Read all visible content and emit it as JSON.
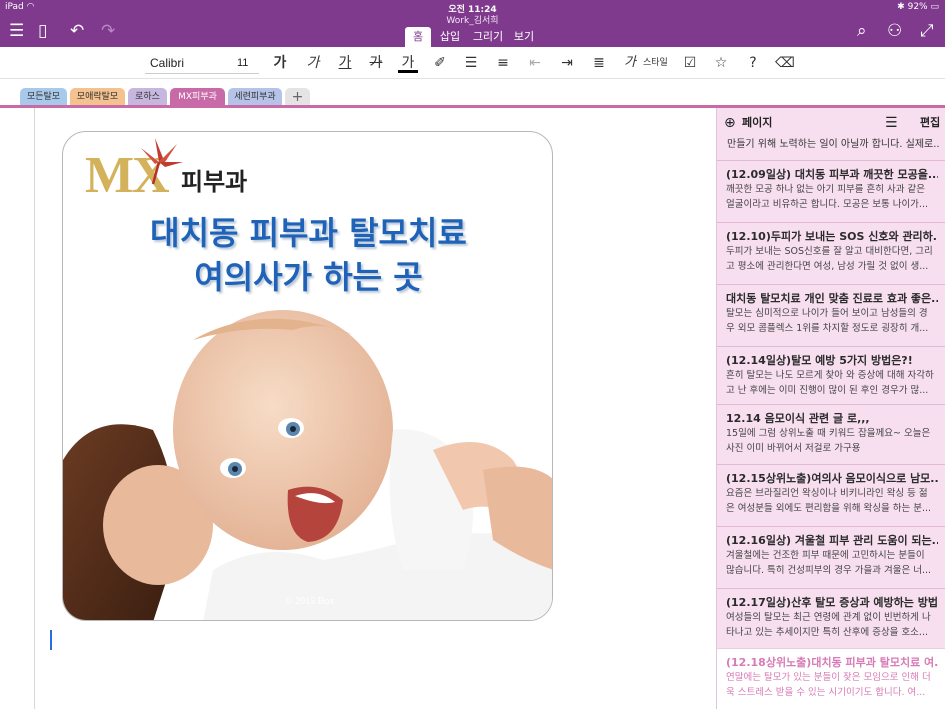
{
  "status": {
    "device": "iPad",
    "time": "오전 11:24",
    "battery": "92%"
  },
  "notebook_title": "Work_김서희",
  "ribbon_tabs": [
    "홈",
    "삽입",
    "그리기",
    "보기"
  ],
  "toolbar": {
    "font_name": "Calibri",
    "font_size": "11",
    "bold": "가",
    "italic": "가",
    "underline": "가",
    "strike": "가",
    "font_color": "가",
    "style_label": "스타일",
    "style_glyph": "가",
    "help": "?"
  },
  "sections": [
    {
      "label": "모든탈모",
      "color": "#a9c9ea"
    },
    {
      "label": "모애락탈모",
      "color": "#f3c28e"
    },
    {
      "label": "로하스",
      "color": "#c7b7de"
    },
    {
      "label": "MX피부과",
      "color": "#c86aa7"
    },
    {
      "label": "세련피부과",
      "color": "#b6c3e8"
    }
  ],
  "card": {
    "logo_mx": "MX",
    "logo_clinic": "피부과",
    "headline_1": "대치동 피부과 탈모치료",
    "headline_2": "여의사가 하는 곳",
    "copyright": "© 2015 Box"
  },
  "panel": {
    "add_label": "페이지",
    "edit_label": "편집",
    "top_snippet": "만들기 위해 노력하는 일이 아닐까 합니다.  실제로...",
    "pages": [
      {
        "title": "(12.09일상) 대치동 피부과 깨끗한 모공을...",
        "line1": "깨끗한 모공 하나 없는 아기 피부를 흔히 사과 같은",
        "line2": "얼굴이라고 비유하곤 합니다.  모공은 보통 나이가..."
      },
      {
        "title": "(12.10)두피가 보내는 SOS 신호와 관리하...",
        "line1": "두피가 보내는 SOS신호를 잘 알고 대비한다면, 그리",
        "line2": "고 평소에 관리한다면 여성, 남성 가릴 것 없이 생..."
      },
      {
        "title": "대치동 탈모치료 개인 맞춤 진료로 효과 좋은...",
        "line1": "탈모는 심미적으로 나이가 들어 보이고 남성들의 경",
        "line2": "우 외모 콤플렉스 1위를 차지할 정도로 굉장히 개..."
      },
      {
        "title": "(12.14일상)탈모 예방 5가지 방법은?!",
        "line1": "흔히 탈모는 나도 모르게 찾아 와 증상에 대해 자각하",
        "line2": "고 난 후에는 이미 진행이 많이 된 후인 경우가 많..."
      },
      {
        "title": "12.14 음모이식 관련 글 로,,,",
        "line1": "15일에 그럼 상위노출 때 키워드 잡을께요~ 오늘은",
        "line2": "사진 이미 바뀌어서 저걸로 가구용"
      },
      {
        "title": "(12.15상위노출)여의사 음모이식으로 남모...",
        "line1": "요즘은 브라질리언 왁싱이나 비키니라인 왁싱 등 젊",
        "line2": "은 여성분들 외에도 편리함을 위해 왁싱을 하는 분..."
      },
      {
        "title": "(12.16일상) 겨울철 피부 관리 도움이 되는...",
        "line1": "겨울철에는 건조한 피부 때문에 고민하시는 분들이",
        "line2": "많습니다.  특히 건성피부의 경우 가을과 겨울은 너..."
      },
      {
        "title": "(12.17일상)산후 탈모 증상과 예방하는 방법...",
        "line1": "여성들의 탈모는 최근 연령에 관계 없이 빈번하게 나",
        "line2": "타나고 있는 추세이지만 특히 산후에 증상을 호소..."
      },
      {
        "title": "(12.18상위노출)대치동 피부과 탈모치료 여...",
        "line1": "연말에는 탈모가 있는 분들이 잦은 모임으로 인해 더",
        "line2": "욱 스트레스 받을 수 있는 시기이기도 합니다.  여..."
      }
    ]
  },
  "colors": {
    "header": "#7f3a8d",
    "panel": "#f7dff0",
    "headline": "#1f63b8",
    "logo_gold": "#d4b25c",
    "selected_text": "#d77bb6"
  }
}
